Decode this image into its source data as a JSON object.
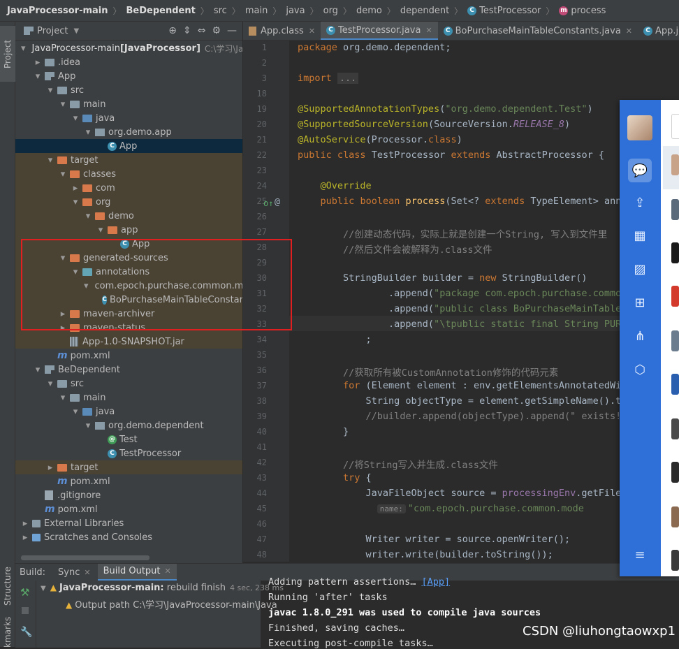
{
  "breadcrumb": [
    "JavaProcessor-main",
    "BeDependent",
    "src",
    "main",
    "java",
    "org",
    "demo",
    "dependent",
    "TestProcessor",
    "process"
  ],
  "left_strip": {
    "project": "Project",
    "structure": "Structure",
    "bookmarks": "kmarks"
  },
  "project_panel": {
    "title": "Project",
    "tree": [
      {
        "label": "JavaProcessor-main",
        "bold": " [JavaProcessor]",
        "extra": "C:\\学习\\Jav"
      },
      {
        "label": ".idea"
      },
      {
        "label": "App"
      },
      {
        "label": "src"
      },
      {
        "label": "main"
      },
      {
        "label": "java"
      },
      {
        "label": "org.demo.app"
      },
      {
        "label": "App"
      },
      {
        "label": "target"
      },
      {
        "label": "classes"
      },
      {
        "label": "com"
      },
      {
        "label": "org"
      },
      {
        "label": "demo"
      },
      {
        "label": "app"
      },
      {
        "label": "App"
      },
      {
        "label": "generated-sources"
      },
      {
        "label": "annotations"
      },
      {
        "label": "com.epoch.purchase.common.mo"
      },
      {
        "label": "BoPurchaseMainTableConstar"
      },
      {
        "label": "maven-archiver"
      },
      {
        "label": "maven-status"
      },
      {
        "label": "App-1.0-SNAPSHOT.jar"
      },
      {
        "label": "pom.xml"
      },
      {
        "label": "BeDependent"
      },
      {
        "label": "src"
      },
      {
        "label": "main"
      },
      {
        "label": "java"
      },
      {
        "label": "org.demo.dependent"
      },
      {
        "label": "Test"
      },
      {
        "label": "TestProcessor"
      },
      {
        "label": "target"
      },
      {
        "label": "pom.xml"
      },
      {
        "label": ".gitignore"
      },
      {
        "label": "pom.xml"
      },
      {
        "label": "External Libraries"
      },
      {
        "label": "Scratches and Consoles"
      }
    ]
  },
  "tabs": [
    {
      "label": "App.class"
    },
    {
      "label": "TestProcessor.java"
    },
    {
      "label": "BoPurchaseMainTableConstants.java"
    },
    {
      "label": "App.java"
    }
  ],
  "editor": {
    "line_numbers": [
      "1",
      "2",
      "3",
      "18",
      "19",
      "20",
      "21",
      "22",
      "23",
      "24",
      "25",
      "26",
      "27",
      "28",
      "29",
      "30",
      "31",
      "32",
      "33",
      "34",
      "35",
      "36",
      "37",
      "38",
      "39",
      "40",
      "41",
      "42",
      "43",
      "44",
      "45",
      "46",
      "47",
      "48"
    ],
    "lines": [
      "package org.demo.dependent;",
      "",
      "import ...",
      "",
      "@SupportedAnnotationTypes(\"org.demo.dependent.Test\")",
      "@SupportedSourceVersion(SourceVersion.RELEASE_8)",
      "@AutoService(Processor.class)",
      "public class TestProcessor extends AbstractProcessor {",
      "",
      "    @Override",
      "    public boolean process(Set<? extends TypeElement> anno",
      "",
      "        //创建动态代码，实际上就是创建一个String, 写入到文件里",
      "        //然后文件会被解释为.class文件",
      "",
      "        StringBuilder builder = new StringBuilder()",
      "                .append(\"package com.epoch.purchase.common",
      "                .append(\"public class BoPurchaseMainTableC",
      "                .append(\"\\tpublic static final String PURC",
      "            ;",
      "",
      "        //获取所有被CustomAnnotation修饰的代码元素",
      "        for (Element element : env.getElementsAnnotatedWit",
      "            String objectType = element.getSimpleName().to",
      "            //builder.append(objectType).append(\" exists!\\",
      "        }",
      "",
      "        //将String写入并生成.class文件",
      "        try {",
      "            JavaFileObject source = processingEnv.getFiler",
      "                    \"com.epoch.purchase.common.mode",
      "",
      "            Writer writer = source.openWriter();",
      "            writer.write(builder.toString());"
    ],
    "param_hint": "name:"
  },
  "build": {
    "label": "Build:",
    "tab_sync": "Sync",
    "tab_output": "Build Output",
    "task": "JavaProcessor-main:",
    "task_status": " rebuild finish",
    "task_time": "4 sec, 238 ms",
    "output_path": "Output path C:\\学习\\JavaProcessor-main\\Java",
    "console": [
      "Adding pattern assertions… [App]",
      "Running 'after' tasks",
      "javac 1.8.0_291 was used to compile java sources",
      "Finished, saving caches…",
      "Executing post-compile tasks…"
    ]
  },
  "watermark": "CSDN @liuhongtaowxp1"
}
